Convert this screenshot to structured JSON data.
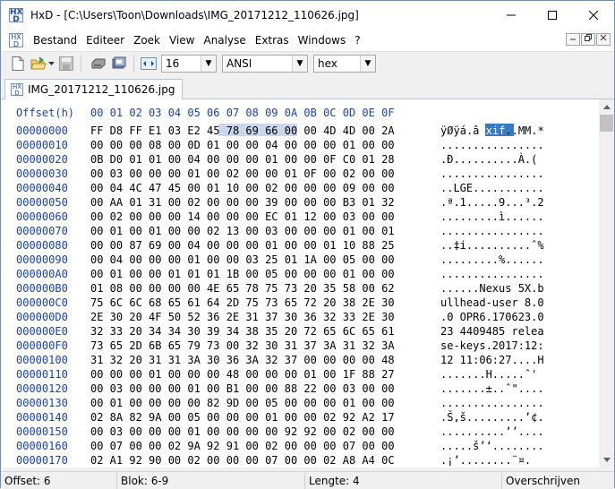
{
  "window": {
    "title": "HxD - [C:\\Users\\Toon\\Downloads\\IMG_20171212_110626.jpg]",
    "app_icon_text": "HxD"
  },
  "menu": {
    "items": [
      "Bestand",
      "Editeer",
      "Zoek",
      "View",
      "Analyse",
      "Extras",
      "Windows",
      "?"
    ]
  },
  "toolbar": {
    "bytes_per_row": "16",
    "charset": "ANSI",
    "offset_base": "hex"
  },
  "tab": {
    "label": "IMG_20171212_110626.jpg"
  },
  "editor": {
    "offset_header": "Offset(h)",
    "columns": [
      "00",
      "01",
      "02",
      "03",
      "04",
      "05",
      "06",
      "07",
      "08",
      "09",
      "0A",
      "0B",
      "0C",
      "0D",
      "0E",
      "0F"
    ],
    "rows": [
      {
        "offset": "00000000",
        "hex": "FF D8 FF E1 03 E2 45 78 69 66 00 00 4D 4D 00 2A",
        "ascii": "ÿØÿá.âExif..MM.*"
      },
      {
        "offset": "00000010",
        "hex": "00 00 00 08 00 0D 01 00 00 04 00 00 00 01 00 00",
        "ascii": "................"
      },
      {
        "offset": "00000020",
        "hex": "0B D0 01 01 00 04 00 00 00 01 00 00 0F C0 01 28",
        "ascii": ".Ð..........À.("
      },
      {
        "offset": "00000030",
        "hex": "00 03 00 00 00 01 00 02 00 00 01 0F 00 02 00 00",
        "ascii": "................"
      },
      {
        "offset": "00000040",
        "hex": "00 04 4C 47 45 00 01 10 00 02 00 00 00 09 00 00",
        "ascii": "..LGE..........."
      },
      {
        "offset": "00000050",
        "hex": "00 AA 01 31 00 02 00 00 00 39 00 00 00 B3 01 32",
        "ascii": ".ª.1.....9...³.2"
      },
      {
        "offset": "00000060",
        "hex": "00 02 00 00 00 14 00 00 00 EC 01 12 00 03 00 00",
        "ascii": ".........ì......"
      },
      {
        "offset": "00000070",
        "hex": "00 01 00 01 00 00 02 13 00 03 00 00 00 01 00 01",
        "ascii": "................"
      },
      {
        "offset": "00000080",
        "hex": "00 00 87 69 00 04 00 00 00 01 00 00 01 10 88 25",
        "ascii": "..‡i..........ˆ%"
      },
      {
        "offset": "00000090",
        "hex": "00 04 00 00 00 01 00 00 03 25 01 1A 00 05 00 00",
        "ascii": ".........%......"
      },
      {
        "offset": "000000A0",
        "hex": "00 01 00 00 01 01 01 1B 00 05 00 00 00 01 00 00",
        "ascii": "................"
      },
      {
        "offset": "000000B0",
        "hex": "01 08 00 00 00 00 4E 65 78 75 73 20 35 58 00 62",
        "ascii": "......Nexus 5X.b"
      },
      {
        "offset": "000000C0",
        "hex": "75 6C 6C 68 65 61 64 2D 75 73 65 72 20 38 2E 30",
        "ascii": "ullhead-user 8.0"
      },
      {
        "offset": "000000D0",
        "hex": "2E 30 20 4F 50 52 36 2E 31 37 30 36 32 33 2E 30",
        "ascii": ".0 OPR6.170623.0"
      },
      {
        "offset": "000000E0",
        "hex": "32 33 20 34 34 30 39 34 38 35 20 72 65 6C 65 61",
        "ascii": "23 4409485 relea"
      },
      {
        "offset": "000000F0",
        "hex": "73 65 2D 6B 65 79 73 00 32 30 31 37 3A 31 32 3A",
        "ascii": "se-keys.2017:12:"
      },
      {
        "offset": "00000100",
        "hex": "31 32 20 31 31 3A 30 36 3A 32 37 00 00 00 00 48",
        "ascii": "12 11:06:27....H"
      },
      {
        "offset": "00000110",
        "hex": "00 00 00 01 00 00 00 48 00 00 00 01 00 1F 88 27",
        "ascii": ".......H.....ˆ'"
      },
      {
        "offset": "00000120",
        "hex": "00 03 00 00 00 01 00 B1 00 00 88 22 00 03 00 00",
        "ascii": ".......±..ˆ\"...."
      },
      {
        "offset": "00000130",
        "hex": "00 01 00 00 00 00 82 9D 00 05 00 00 00 01 00 00",
        "ascii": "................"
      },
      {
        "offset": "00000140",
        "hex": "02 8A 82 9A 00 05 00 00 00 01 00 00 02 92 A2 17",
        "ascii": ".Š‚š.........’¢."
      },
      {
        "offset": "00000150",
        "hex": "00 03 00 00 00 01 00 00 00 00 92 92 00 02 00 00",
        "ascii": "..........’’...."
      },
      {
        "offset": "00000160",
        "hex": "00 07 00 00 02 9A 92 91 00 02 00 00 00 07 00 00",
        "ascii": ".....š’‘........"
      },
      {
        "offset": "00000170",
        "hex": "02 A1 92 90 00 02 00 00 00 07 00 00 02 A8 A4 0C",
        "ascii": ".¡’........¨¤."
      }
    ]
  },
  "status": {
    "offset": "Offset: 6",
    "block": "Blok: 6-9",
    "length": "Lengte: 4",
    "mode": "Overschrijven"
  },
  "colors": {
    "offset_blue": "#1a3fb0",
    "selection_light": "#c9d8ec",
    "selection_dark": "#3a79c4"
  }
}
